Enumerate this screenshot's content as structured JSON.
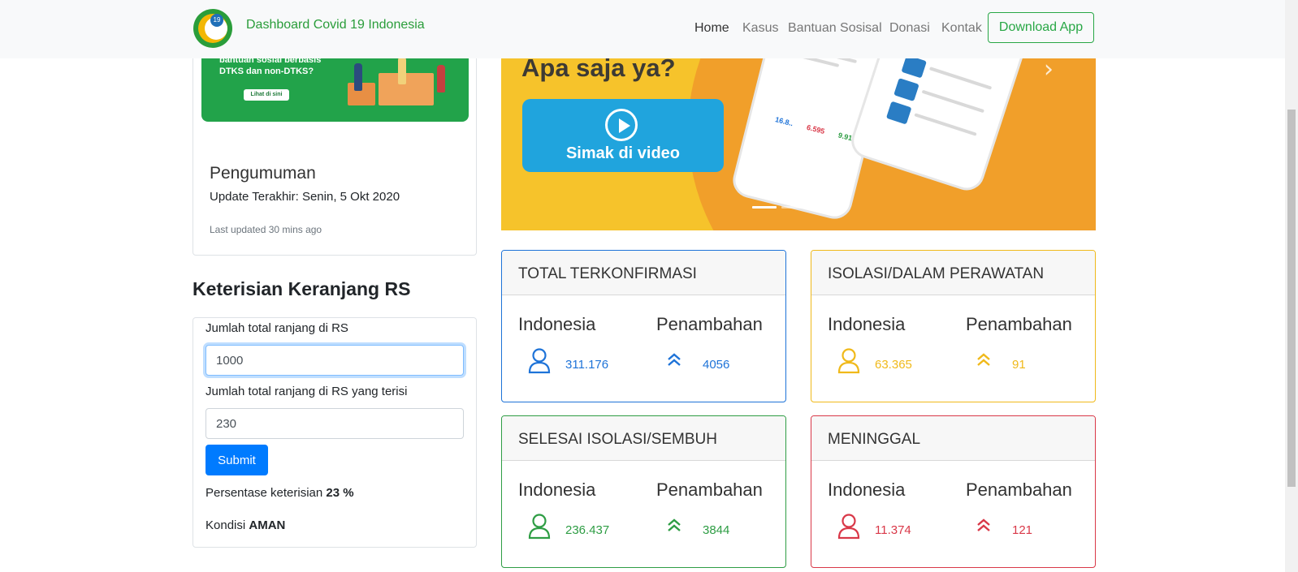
{
  "navbar": {
    "brand": "Dashboard Covid 19 Indonesia",
    "logo_number": "19",
    "links": [
      "Home",
      "Kasus",
      "Bantuan Sosisal",
      "Donasi",
      "Kontak"
    ],
    "download_button": "Download App"
  },
  "promo": {
    "line1": "bantuan sosial berbasis",
    "line2": "DTKS dan non-DTKS?",
    "button": "Lihat di sini"
  },
  "announcement": {
    "title": "Pengumuman",
    "update": "Update Terakhir: Senin, 5 Okt 2020",
    "last_updated": "Last updated 30 mins ago"
  },
  "bed_occupancy": {
    "title": "Keterisian Keranjang RS",
    "total_label": "Jumlah total ranjang di RS",
    "total_value": "1000",
    "filled_label": "Jumlah total ranjang di RS yang terisi",
    "filled_value": "230",
    "submit": "Submit",
    "percentage_label": "Persentase keterisian",
    "percentage_value": "23 %",
    "condition_label": "Kondisi",
    "condition_value": "AMAN"
  },
  "banner": {
    "title": "Apa saja ya?",
    "video_button": "Simak di video"
  },
  "stats": [
    {
      "title": "TOTAL TERKONFIRMASI",
      "label_indonesia": "Indonesia",
      "label_increase": "Penambahan",
      "total": "311.176",
      "increase": "4056",
      "color": "#1e73d8"
    },
    {
      "title": "ISOLASI/DALAM PERAWATAN",
      "label_indonesia": "Indonesia",
      "label_increase": "Penambahan",
      "total": "63.365",
      "increase": "91",
      "color": "#f0b91a"
    },
    {
      "title": "SELESAI ISOLASI/SEMBUH",
      "label_indonesia": "Indonesia",
      "label_increase": "Penambahan",
      "total": "236.437",
      "increase": "3844",
      "color": "#2e9d44"
    },
    {
      "title": "MENINGGAL",
      "label_indonesia": "Indonesia",
      "label_increase": "Penambahan",
      "total": "11.374",
      "increase": "121",
      "color": "#d93848"
    }
  ]
}
